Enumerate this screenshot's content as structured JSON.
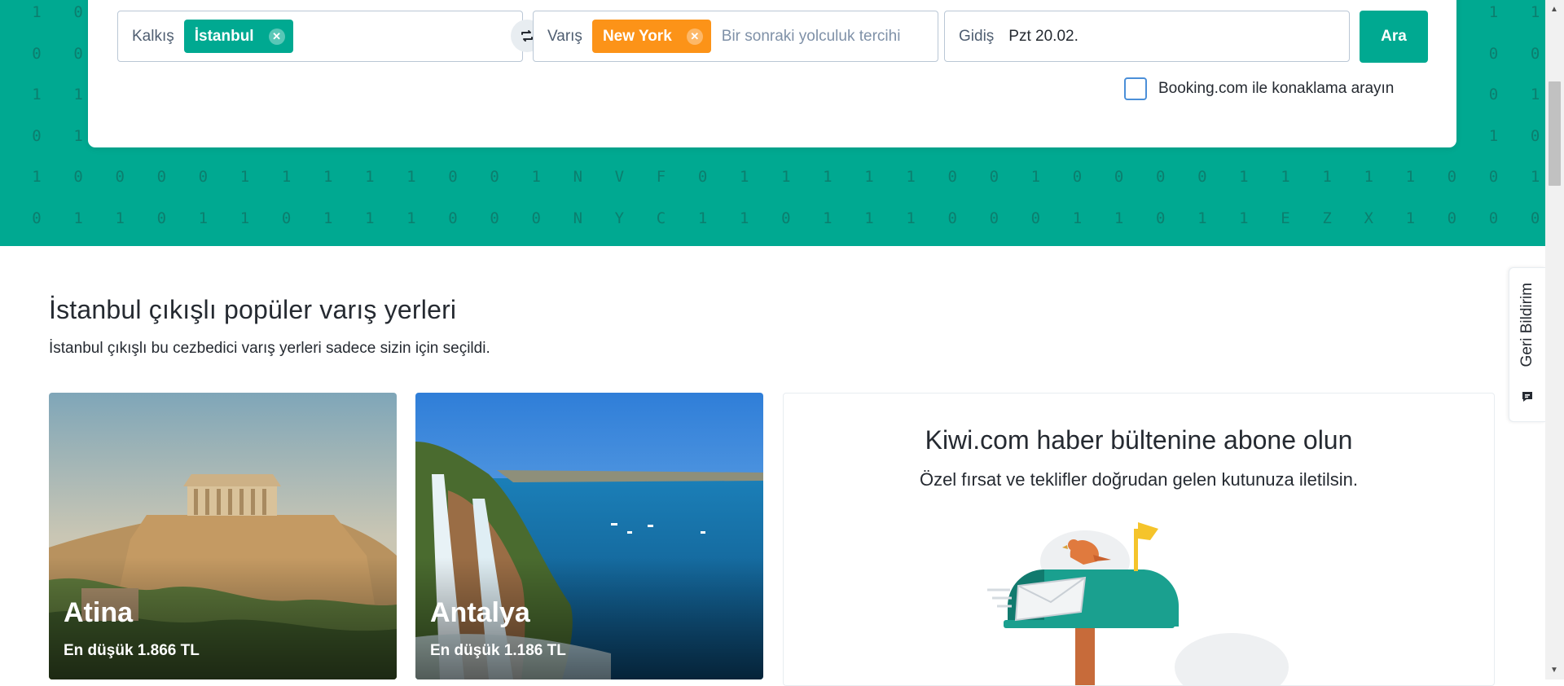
{
  "search": {
    "from_label": "Kalkış",
    "from_value": "İstanbul",
    "to_label": "Varış",
    "to_value": "New York",
    "to_placeholder": "Bir sonraki yolculuk tercihi",
    "date_label": "Gidiş",
    "date_value": "Pzt 20.02.",
    "search_button": "Ara",
    "booking_label": "Booking.com ile konaklama arayın",
    "swap_icon": "swap-icon"
  },
  "hero": {
    "digit_rows": [
      [
        "1",
        "0",
        "",
        "",
        "",
        "",
        "",
        "",
        "",
        "",
        "",
        "",
        "",
        "",
        "",
        "",
        "",
        "",
        "",
        "",
        "",
        "",
        "",
        "",
        "",
        "",
        "",
        "",
        "",
        "",
        "",
        "",
        "",
        "",
        "",
        "1",
        "1"
      ],
      [
        "0",
        "0",
        "",
        "",
        "",
        "",
        "",
        "",
        "",
        "",
        "",
        "",
        "",
        "",
        "",
        "",
        "",
        "",
        "",
        "",
        "",
        "",
        "",
        "",
        "",
        "",
        "",
        "",
        "",
        "",
        "",
        "",
        "",
        "",
        "",
        "0",
        "0"
      ],
      [
        "1",
        "1",
        "",
        "",
        "",
        "",
        "",
        "",
        "",
        "",
        "",
        "",
        "",
        "",
        "",
        "",
        "",
        "",
        "",
        "",
        "",
        "",
        "",
        "",
        "",
        "",
        "",
        "",
        "",
        "",
        "",
        "",
        "",
        "",
        "",
        "0",
        "1"
      ],
      [
        "0",
        "1",
        "",
        "",
        "",
        "",
        "",
        "",
        "",
        "",
        "",
        "",
        "",
        "",
        "",
        "",
        "",
        "",
        "",
        "",
        "",
        "",
        "",
        "",
        "",
        "",
        "",
        "",
        "",
        "",
        "",
        "",
        "",
        "",
        "",
        "1",
        "0"
      ],
      [
        "1",
        "0",
        "0",
        "0",
        "0",
        "1",
        "1",
        "1",
        "1",
        "1",
        "0",
        "0",
        "1",
        "N",
        "V",
        "F",
        "0",
        "1",
        "1",
        "1",
        "1",
        "1",
        "0",
        "0",
        "1",
        "0",
        "0",
        "0",
        "0",
        "1",
        "1",
        "1",
        "1",
        "1",
        "0",
        "0",
        "1"
      ],
      [
        "0",
        "1",
        "1",
        "0",
        "1",
        "1",
        "0",
        "1",
        "1",
        "1",
        "0",
        "0",
        "0",
        "N",
        "Y",
        "C",
        "1",
        "1",
        "0",
        "1",
        "1",
        "1",
        "0",
        "0",
        "0",
        "1",
        "1",
        "0",
        "1",
        "1",
        "E",
        "Z",
        "X",
        "1",
        "0",
        "0",
        "0"
      ]
    ]
  },
  "popular": {
    "title": "İstanbul çıkışlı popüler varış yerleri",
    "subtitle": "İstanbul çıkışlı bu cezbedici varış yerleri sadece sizin için seçildi.",
    "destinations": [
      {
        "name": "Atina",
        "price": "En düşük 1.866 TL"
      },
      {
        "name": "Antalya",
        "price": "En düşük 1.186 TL"
      }
    ]
  },
  "newsletter": {
    "title": "Kiwi.com haber bültenine abone olun",
    "subtitle": "Özel fırsat ve teklifler doğrudan gelen kutunuza iletilsin."
  },
  "feedback": {
    "label": "Geri Bildirim"
  }
}
